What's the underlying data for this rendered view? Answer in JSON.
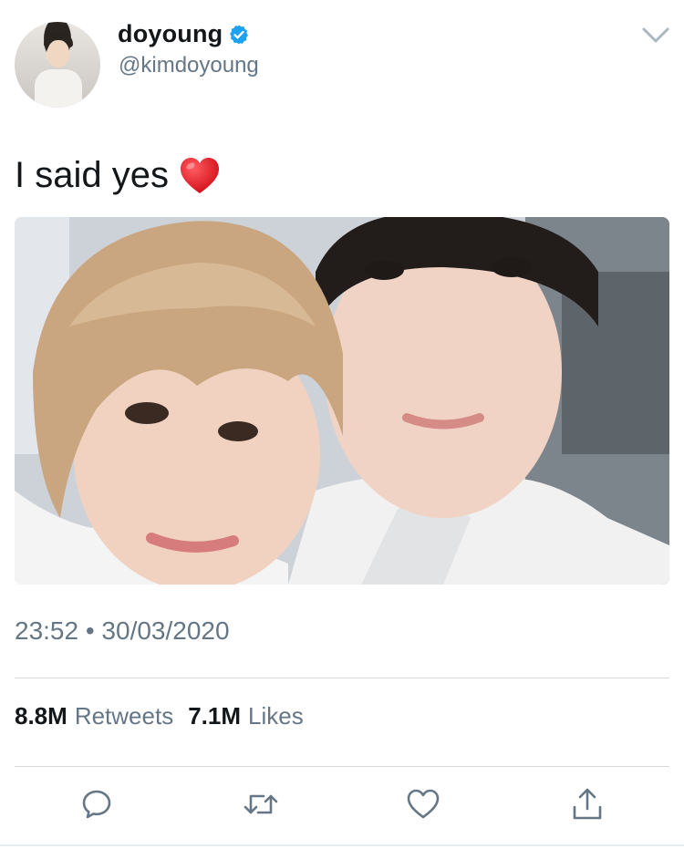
{
  "author": {
    "display_name": "doyoung",
    "handle": "@kimdoyoung",
    "verified": true,
    "avatar_icon": "avatar-photo"
  },
  "tweet": {
    "text": "I said yes",
    "emoji": "red-heart-emoji",
    "timestamp": "23:52 • 30/03/2020"
  },
  "stats": {
    "retweets_count": "8.8M",
    "retweets_label": "Retweets",
    "likes_count": "7.1M",
    "likes_label": "Likes"
  },
  "actions": [
    {
      "name": "reply-icon"
    },
    {
      "name": "retweet-icon"
    },
    {
      "name": "like-icon"
    },
    {
      "name": "share-icon"
    }
  ],
  "colors": {
    "text": "#14171a",
    "secondary": "#657786",
    "verified": "#1da1f2",
    "divider": "#d6dade",
    "heart": "#e0242b"
  }
}
